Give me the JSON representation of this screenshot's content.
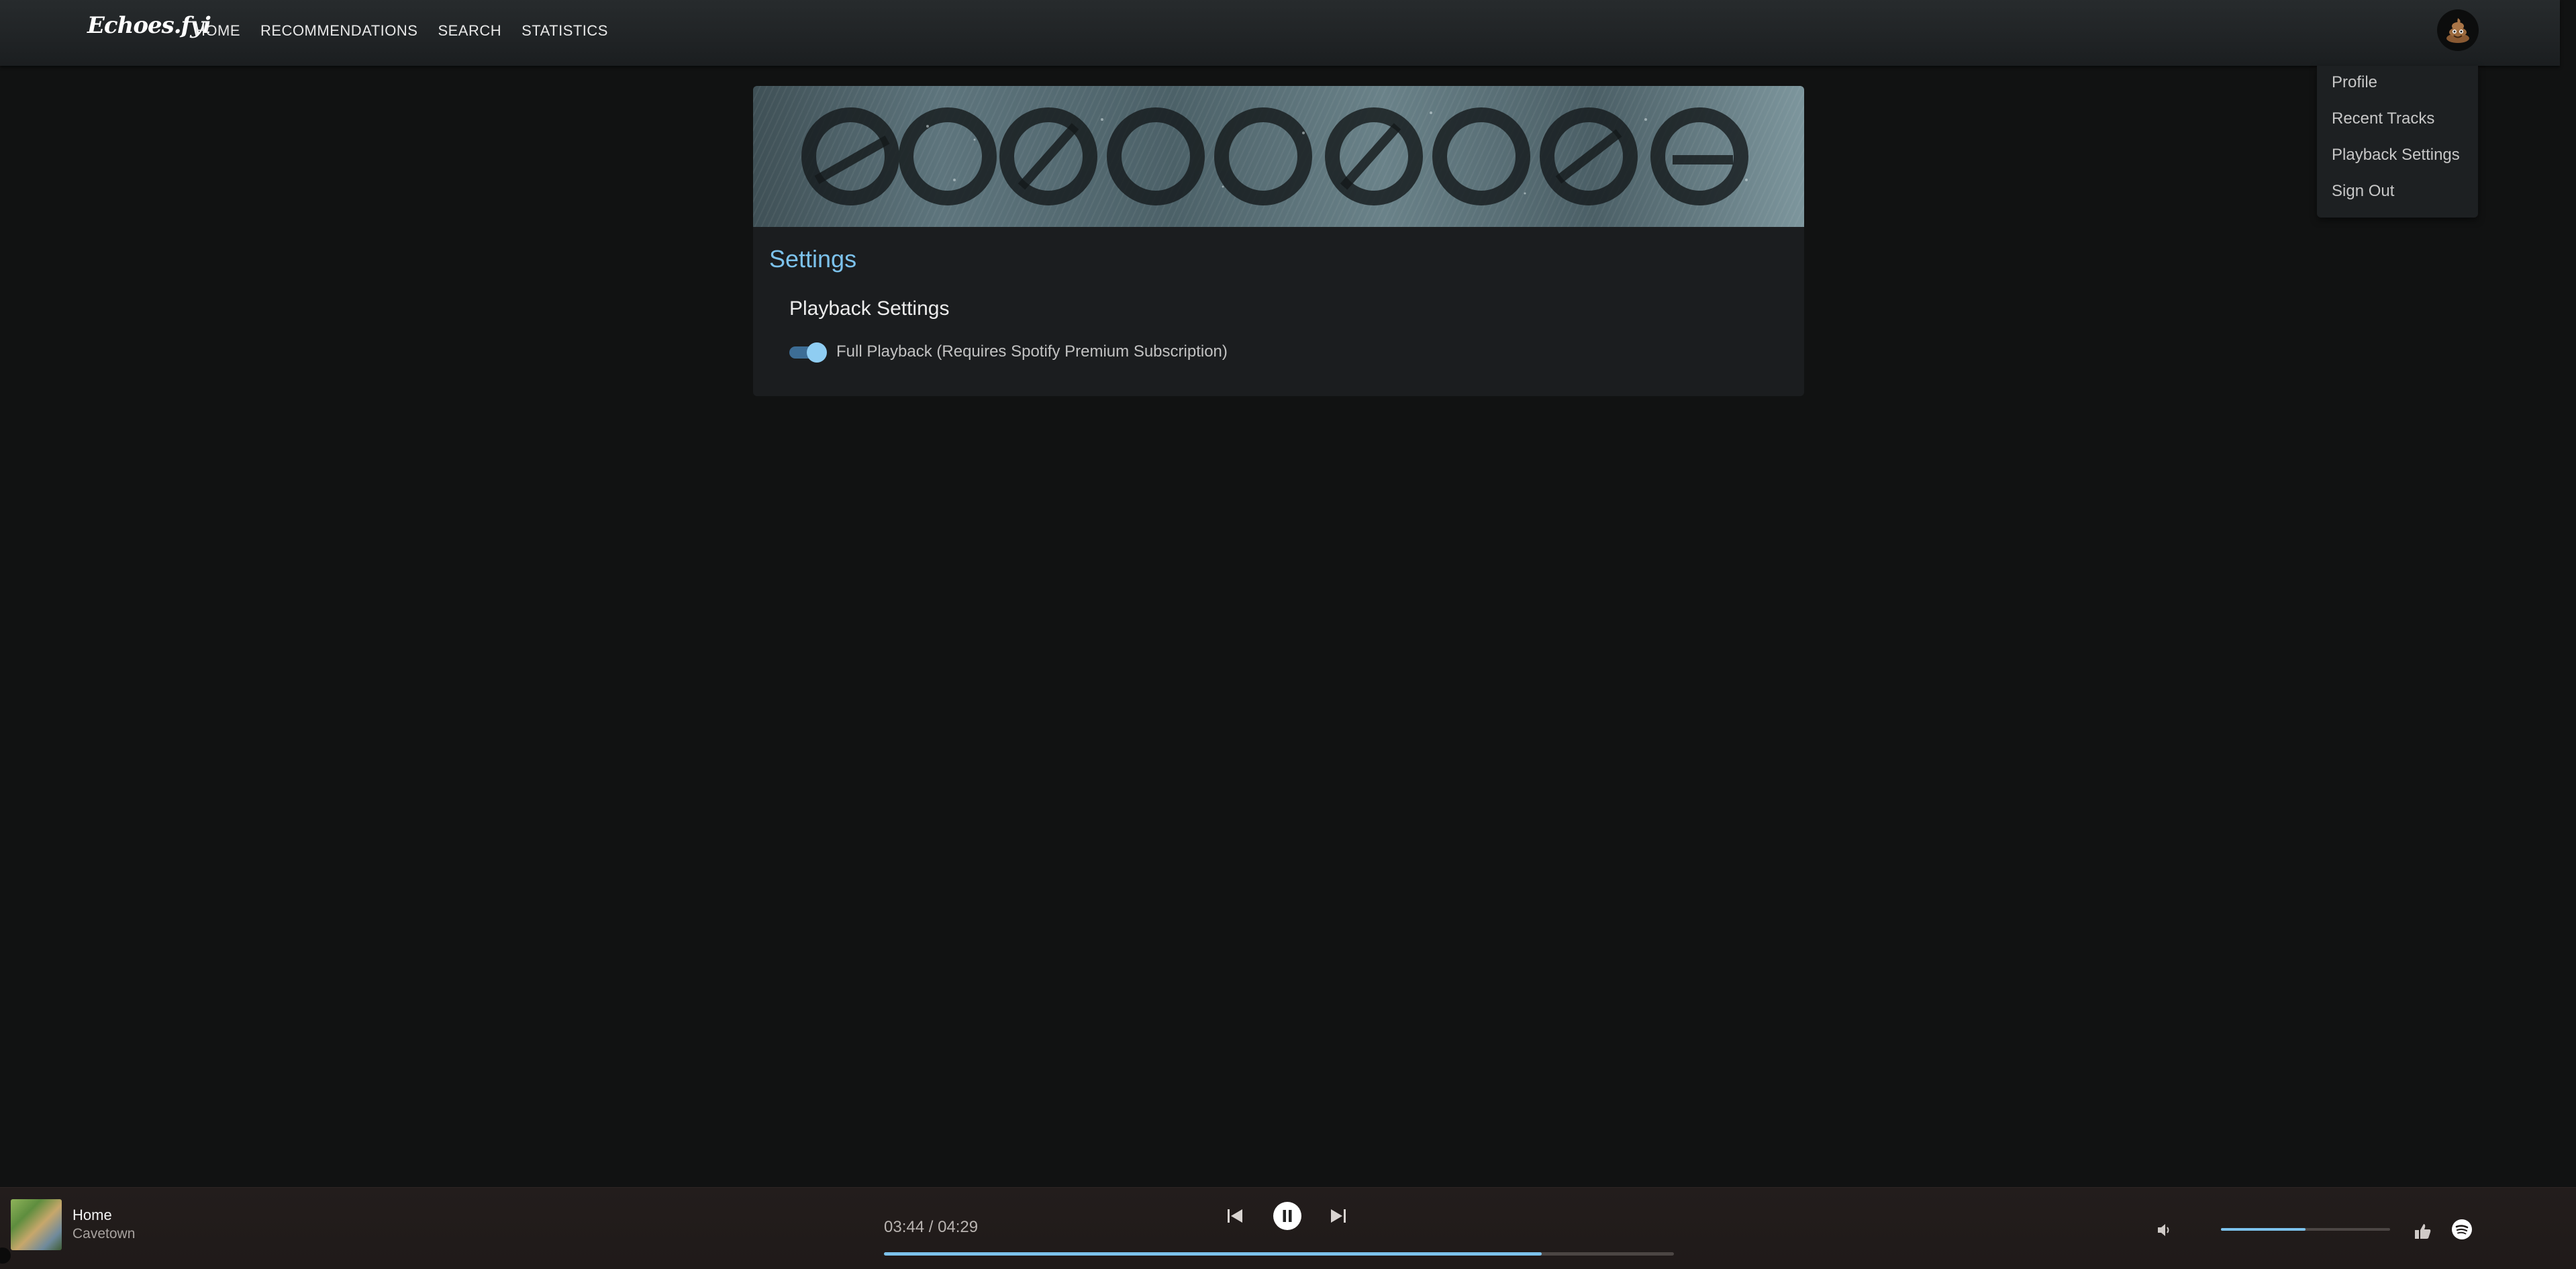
{
  "header": {
    "brand": "Echoes.fyi",
    "nav": [
      {
        "label": "HOME"
      },
      {
        "label": "RECOMMENDATIONS"
      },
      {
        "label": "SEARCH"
      },
      {
        "label": "STATISTICS"
      }
    ],
    "avatar_icon": "poop-emoji-avatar"
  },
  "user_menu": {
    "items": [
      {
        "label": "Profile"
      },
      {
        "label": "Recent Tracks"
      },
      {
        "label": "Playback Settings"
      },
      {
        "label": "Sign Out"
      }
    ]
  },
  "settings": {
    "title": "Settings",
    "section_title": "Playback Settings",
    "full_playback": {
      "label": "Full Playback (Requires Spotify Premium Subscription)",
      "enabled": true
    }
  },
  "player": {
    "track_title": "Home",
    "artist": "Cavetown",
    "time_display": "03:44 / 04:29",
    "progress_fraction": 0.833,
    "volume_fraction": 0.5,
    "accent_color": "#7cc2ec",
    "icons": {
      "previous": "skip-previous-icon",
      "pause": "pause-icon",
      "next": "skip-next-icon",
      "volume": "volume-icon",
      "like": "thumbs-up-icon",
      "spotify": "spotify-icon"
    }
  }
}
